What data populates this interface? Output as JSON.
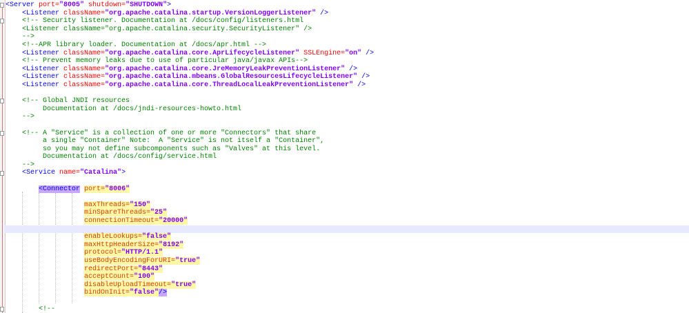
{
  "editor": {
    "current_line": 29,
    "colors": {
      "tag": "#0000ff",
      "attribute": "#ff0000",
      "value": "#8000ff",
      "comment": "#008000",
      "current_line": "#e8e8ff",
      "smart_highlight": "#fff7a8",
      "match_highlight": "#c8a8ff"
    },
    "fold_markers": [
      1,
      3,
      13,
      17,
      22,
      39
    ]
  },
  "lines": [
    {
      "s": [
        {
          "t": "<Server",
          "c": "tag"
        },
        {
          "t": " port=",
          "c": "attr"
        },
        {
          "t": "\"8005\"",
          "c": "val"
        },
        {
          "t": " shutdown=",
          "c": "attr"
        },
        {
          "t": "\"SHUTDOWN\"",
          "c": "val"
        },
        {
          "t": ">",
          "c": "tag"
        }
      ]
    },
    {
      "s": [
        {
          "t": "    ",
          "c": "plain"
        },
        {
          "t": "<Listener",
          "c": "tag"
        },
        {
          "t": " className=",
          "c": "attr"
        },
        {
          "t": "\"org.apache.catalina.startup.VersionLoggerListener\"",
          "c": "val"
        },
        {
          "t": " />",
          "c": "tag"
        }
      ]
    },
    {
      "s": [
        {
          "t": "    <!-- Security listener. Documentation at /docs/config/listeners.html",
          "c": "cmt"
        }
      ]
    },
    {
      "s": [
        {
          "t": "    <Listener className=\"org.apache.catalina.security.SecurityListener\" />",
          "c": "cmt"
        }
      ]
    },
    {
      "s": [
        {
          "t": "    -->",
          "c": "cmt"
        }
      ]
    },
    {
      "s": [
        {
          "t": "    <!--APR library loader. Documentation at /docs/apr.html -->",
          "c": "cmt"
        }
      ]
    },
    {
      "s": [
        {
          "t": "    ",
          "c": "plain"
        },
        {
          "t": "<Listener",
          "c": "tag"
        },
        {
          "t": " className=",
          "c": "attr"
        },
        {
          "t": "\"org.apache.catalina.core.AprLifecycleListener\"",
          "c": "val"
        },
        {
          "t": " SSLEngine=",
          "c": "attr"
        },
        {
          "t": "\"on\"",
          "c": "val"
        },
        {
          "t": " />",
          "c": "tag"
        }
      ]
    },
    {
      "s": [
        {
          "t": "    <!-- Prevent memory leaks due to use of particular java/javax APIs-->",
          "c": "cmt"
        }
      ]
    },
    {
      "s": [
        {
          "t": "    ",
          "c": "plain"
        },
        {
          "t": "<Listener",
          "c": "tag"
        },
        {
          "t": " className=",
          "c": "attr"
        },
        {
          "t": "\"org.apache.catalina.core.JreMemoryLeakPreventionListener\"",
          "c": "val"
        },
        {
          "t": " />",
          "c": "tag"
        }
      ]
    },
    {
      "s": [
        {
          "t": "    ",
          "c": "plain"
        },
        {
          "t": "<Listener",
          "c": "tag"
        },
        {
          "t": " className=",
          "c": "attr"
        },
        {
          "t": "\"org.apache.catalina.mbeans.GlobalResourcesLifecycleListener\"",
          "c": "val"
        },
        {
          "t": " />",
          "c": "tag"
        }
      ]
    },
    {
      "s": [
        {
          "t": "    ",
          "c": "plain"
        },
        {
          "t": "<Listener",
          "c": "tag"
        },
        {
          "t": " className=",
          "c": "attr"
        },
        {
          "t": "\"org.apache.catalina.core.ThreadLocalLeakPreventionListener\"",
          "c": "val"
        },
        {
          "t": " />",
          "c": "tag"
        }
      ]
    },
    {
      "s": []
    },
    {
      "s": [
        {
          "t": "    <!-- Global JNDI resources",
          "c": "cmt"
        }
      ]
    },
    {
      "s": [
        {
          "t": "         Documentation at /docs/jndi-resources-howto.html",
          "c": "cmt"
        }
      ]
    },
    {
      "s": [
        {
          "t": "    -->",
          "c": "cmt"
        }
      ]
    },
    {
      "s": []
    },
    {
      "s": [
        {
          "t": "    <!-- A \"Service\" is a collection of one or more \"Connectors\" that share",
          "c": "cmt"
        }
      ]
    },
    {
      "s": [
        {
          "t": "         a single \"Container\" Note:  A \"Service\" is not itself a \"Container\",",
          "c": "cmt"
        }
      ]
    },
    {
      "s": [
        {
          "t": "         so you may not define subcomponents such as \"Valves\" at this level.",
          "c": "cmt"
        }
      ]
    },
    {
      "s": [
        {
          "t": "         Documentation at /docs/config/service.html",
          "c": "cmt"
        }
      ]
    },
    {
      "s": [
        {
          "t": "    -->",
          "c": "cmt"
        }
      ]
    },
    {
      "s": [
        {
          "t": "    ",
          "c": "plain"
        },
        {
          "t": "<Service",
          "c": "tag"
        },
        {
          "t": " name=",
          "c": "attr"
        },
        {
          "t": "\"Catalina\"",
          "c": "val"
        },
        {
          "t": ">",
          "c": "tag"
        }
      ]
    },
    {
      "s": []
    },
    {
      "s": [
        {
          "t": "        ",
          "c": "plain"
        },
        {
          "t": "<Connector",
          "c": "tag hlp"
        },
        {
          "t": " ",
          "c": "plain"
        },
        {
          "t": "port=",
          "c": "attr hly"
        },
        {
          "t": "\"8006\"",
          "c": "val hly"
        }
      ]
    },
    {
      "s": []
    },
    {
      "s": [
        {
          "t": "                   ",
          "c": "plain"
        },
        {
          "t": "maxThreads=",
          "c": "attr hly"
        },
        {
          "t": "\"150\"",
          "c": "val hly"
        }
      ]
    },
    {
      "s": [
        {
          "t": "                   ",
          "c": "plain"
        },
        {
          "t": "minSpareThreads=",
          "c": "attr hly"
        },
        {
          "t": "\"25\"",
          "c": "val hly"
        }
      ]
    },
    {
      "s": [
        {
          "t": "                   ",
          "c": "plain"
        },
        {
          "t": "connectionTimeout=",
          "c": "attr hly"
        },
        {
          "t": "\"20000\"",
          "c": "val hly"
        }
      ]
    },
    {
      "s": []
    },
    {
      "s": [
        {
          "t": "                   ",
          "c": "plain"
        },
        {
          "t": "enableLookups=",
          "c": "attr hly"
        },
        {
          "t": "\"false\"",
          "c": "val hly"
        }
      ]
    },
    {
      "s": [
        {
          "t": "                   ",
          "c": "plain"
        },
        {
          "t": "maxHttpHeaderSize=",
          "c": "attr hly"
        },
        {
          "t": "\"8192\"",
          "c": "val hly"
        }
      ]
    },
    {
      "s": [
        {
          "t": "                   ",
          "c": "plain"
        },
        {
          "t": "protocol=",
          "c": "attr hly"
        },
        {
          "t": "\"HTTP/1.1\"",
          "c": "val hly"
        }
      ]
    },
    {
      "s": [
        {
          "t": "                   ",
          "c": "plain"
        },
        {
          "t": "useBodyEncodingForURI=",
          "c": "attr hly"
        },
        {
          "t": "\"true\"",
          "c": "val hly"
        }
      ]
    },
    {
      "s": [
        {
          "t": "                   ",
          "c": "plain"
        },
        {
          "t": "redirectPort=",
          "c": "attr hly"
        },
        {
          "t": "\"8443\"",
          "c": "val hly"
        }
      ]
    },
    {
      "s": [
        {
          "t": "                   ",
          "c": "plain"
        },
        {
          "t": "acceptCount=",
          "c": "attr hly"
        },
        {
          "t": "\"100\"",
          "c": "val hly"
        }
      ]
    },
    {
      "s": [
        {
          "t": "                   ",
          "c": "plain"
        },
        {
          "t": "disableUploadTimeout=",
          "c": "attr hly"
        },
        {
          "t": "\"true\"",
          "c": "val hly"
        }
      ]
    },
    {
      "s": [
        {
          "t": "                   ",
          "c": "plain"
        },
        {
          "t": "bindOnInit=",
          "c": "attr hly"
        },
        {
          "t": "\"false\"",
          "c": "val hly"
        },
        {
          "t": "/>",
          "c": "tag hlp"
        }
      ]
    },
    {
      "s": []
    },
    {
      "s": [
        {
          "t": "        <!--",
          "c": "cmt"
        }
      ]
    }
  ]
}
